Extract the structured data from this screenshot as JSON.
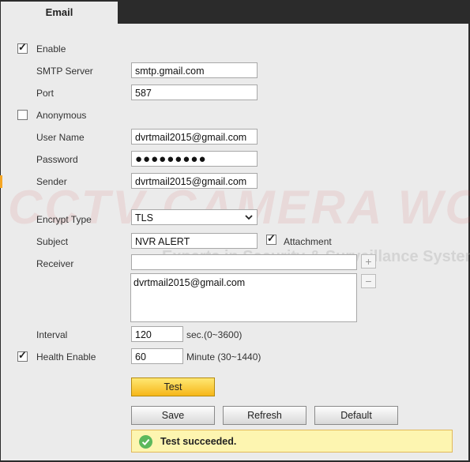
{
  "tab": {
    "title": "Email"
  },
  "watermark": {
    "main": "CCTV CAMERA WORLD",
    "sub": "Experts in Security & Surveillance Systems"
  },
  "form": {
    "enable": {
      "label": "Enable",
      "checked": true
    },
    "smtp_server": {
      "label": "SMTP Server",
      "value": "smtp.gmail.com"
    },
    "port": {
      "label": "Port",
      "value": "587"
    },
    "anonymous": {
      "label": "Anonymous",
      "checked": false
    },
    "user_name": {
      "label": "User Name",
      "value": "dvrtmail2015@gmail.com"
    },
    "password": {
      "label": "Password",
      "masked": "●●●●●●●●●"
    },
    "sender": {
      "label": "Sender",
      "value": "dvrtmail2015@gmail.com"
    },
    "encrypt_type": {
      "label": "Encrypt Type",
      "value": "TLS"
    },
    "subject": {
      "label": "Subject",
      "value": "NVR ALERT"
    },
    "attachment": {
      "label": "Attachment",
      "checked": true
    },
    "receiver": {
      "label": "Receiver",
      "value": "",
      "list": [
        "dvrtmail2015@gmail.com"
      ],
      "add": "+",
      "remove": "−"
    },
    "interval": {
      "label": "Interval",
      "value": "120",
      "unit": "sec.(0~3600)"
    },
    "health_enable": {
      "label": "Health Enable",
      "checked": true,
      "value": "60",
      "unit": "Minute (30~1440)"
    }
  },
  "buttons": {
    "test": "Test",
    "save": "Save",
    "refresh": "Refresh",
    "default": "Default"
  },
  "status": {
    "message": "Test succeeded.",
    "icon": "check-circle-icon",
    "color": "#5cb85c"
  },
  "colors": {
    "accent": "#f5a623",
    "frame": "#2b2b2b",
    "status_bg": "#fdf5b0",
    "test_button": "#f6b619"
  }
}
